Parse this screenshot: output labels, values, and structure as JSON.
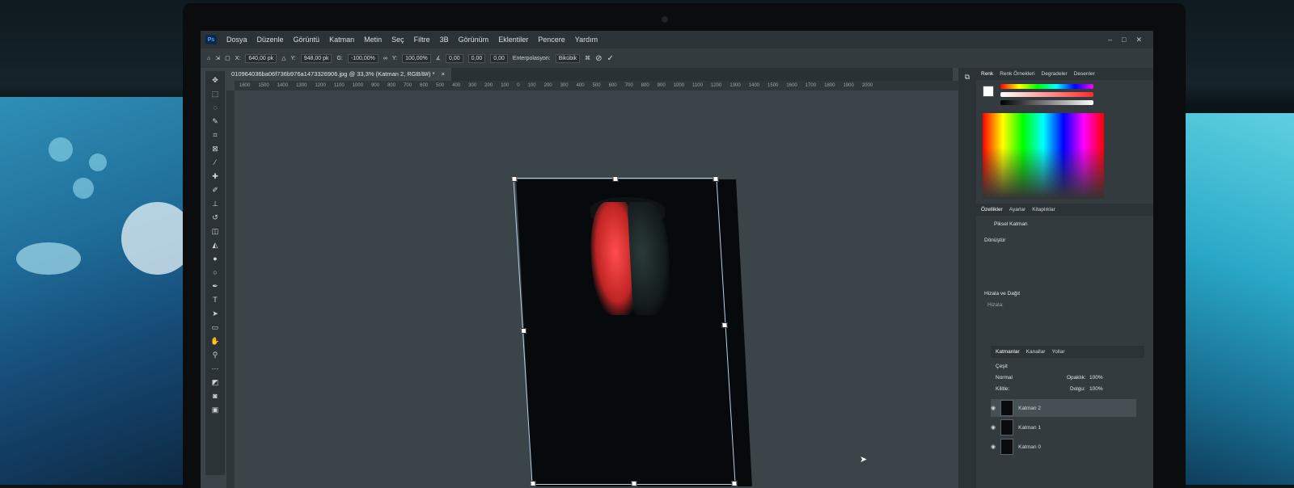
{
  "menubar": {
    "logo": "Ps",
    "items": [
      "Dosya",
      "Düzenle",
      "Görüntü",
      "Katman",
      "Metin",
      "Seç",
      "Filtre",
      "3B",
      "Görünüm",
      "Eklentiler",
      "Pencere",
      "Yardım"
    ]
  },
  "options": {
    "x_label": "X:",
    "x_value": "640,00 pk",
    "y_label": "Y:",
    "y_value": "948,00 pk",
    "w_label": "G:",
    "w_value": "-100,00%",
    "h_label": "Y:",
    "h_value": "100,00%",
    "angle_value": "0,00",
    "skew_h_value": "0,00",
    "skew_v_value": "0,00",
    "interp_label": "Enterpolasyon:",
    "interp_value": "Bikübik"
  },
  "document": {
    "tab_title": "010964036ba06f736b976a1473326906.jpg @ 33,3% (Katman 2, RGB/8#) *",
    "close": "×"
  },
  "ruler_ticks": [
    "1600",
    "1500",
    "1400",
    "1300",
    "1200",
    "1100",
    "1000",
    "900",
    "800",
    "700",
    "600",
    "500",
    "400",
    "300",
    "200",
    "100",
    "0",
    "100",
    "200",
    "300",
    "400",
    "500",
    "600",
    "700",
    "800",
    "900",
    "1000",
    "1100",
    "1200",
    "1300",
    "1400",
    "1500",
    "1600",
    "1700",
    "1800",
    "1900",
    "2000"
  ],
  "panel": {
    "top_tabs": [
      "Renk",
      "Renk Örnekleri",
      "Degradeler",
      "Desenler"
    ],
    "props_tabs": [
      "Özellikler",
      "Ayarlar",
      "Kitaplıklar"
    ],
    "pixel_layer": "Piksel Katman",
    "transform": "Dönüştür",
    "align": "Hizala ve Dağıt",
    "align_sub": "Hizala:",
    "layers_tabs": [
      "Katmanlar",
      "Kanallar",
      "Yollar"
    ],
    "search": "Çeşit",
    "blend_mode": "Normal",
    "opacity_label": "Opaklık:",
    "opacity_value": "100%",
    "lock_label": "Kilitle:",
    "fill_label": "Dolgu:",
    "fill_value": "100%",
    "layers": [
      "Katman 2",
      "Katman 1",
      "Katman 0"
    ]
  },
  "colors": {
    "accent": "#4aa3ff",
    "canvas": "#3b4448",
    "menubar": "#2c3337"
  }
}
